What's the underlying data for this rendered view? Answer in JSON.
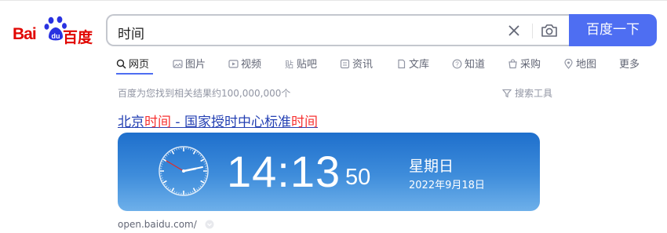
{
  "logo": {
    "left": "Bai",
    "paw_text": "du",
    "right": "百度"
  },
  "search": {
    "value": "时间",
    "button_label": "百度一下"
  },
  "tabs": [
    {
      "label": "网页",
      "icon": "search-icon",
      "active": true
    },
    {
      "label": "图片",
      "icon": "image-icon"
    },
    {
      "label": "视频",
      "icon": "video-icon"
    },
    {
      "label": "贴吧",
      "icon": "tieba-icon"
    },
    {
      "label": "资讯",
      "icon": "news-icon"
    },
    {
      "label": "文库",
      "icon": "doc-icon"
    },
    {
      "label": "知道",
      "icon": "question-icon"
    },
    {
      "label": "采购",
      "icon": "shop-icon"
    },
    {
      "label": "地图",
      "icon": "map-icon"
    },
    {
      "label": "更多",
      "icon": ""
    }
  ],
  "results_meta": {
    "count_text": "百度为您找到相关结果约100,000,000个",
    "tools_label": "搜索工具"
  },
  "result": {
    "title_parts": [
      {
        "text": "北京",
        "highlight": false
      },
      {
        "text": "时间",
        "highlight": true
      },
      {
        "text": " - 国家授时中心标准",
        "highlight": false
      },
      {
        "text": "时间",
        "highlight": true
      }
    ],
    "clock": {
      "time": "14:13",
      "seconds": "50",
      "weekday": "星期日",
      "date": "2022年9月18日"
    },
    "url": "open.baidu.com/"
  },
  "colors": {
    "brand_red": "#e10601",
    "brand_blue": "#4e6ef2",
    "link": "#2440b3",
    "highlight": "#f73131"
  }
}
